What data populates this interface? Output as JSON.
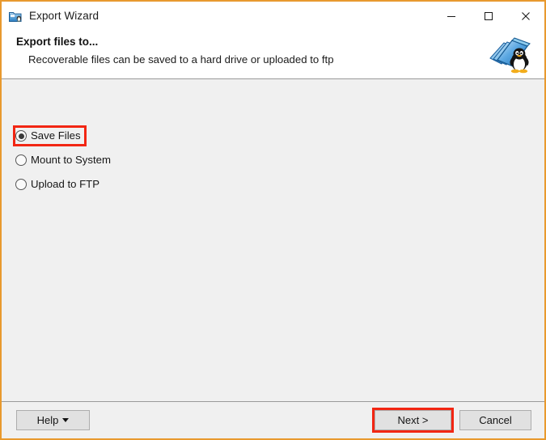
{
  "window": {
    "title": "Export Wizard",
    "icon": "folder-penguin-icon",
    "border_color": "#E8992E",
    "controls": [
      {
        "name": "minimize",
        "glyph": "minimize-icon"
      },
      {
        "name": "maximize",
        "glyph": "maximize-icon"
      },
      {
        "name": "close",
        "glyph": "close-icon"
      }
    ]
  },
  "header": {
    "title": "Export files to...",
    "subtitle": "Recoverable files can be saved to a hard drive or uploaded to ftp",
    "logo": "linux-tux-folder-logo"
  },
  "content": {
    "options": [
      {
        "label": "Save Files",
        "selected": true,
        "highlighted": true
      },
      {
        "label": "Mount to System",
        "selected": false,
        "highlighted": false
      },
      {
        "label": "Upload to FTP",
        "selected": false,
        "highlighted": false
      }
    ]
  },
  "footer": {
    "help_label": "Help",
    "next_label": "Next >",
    "cancel_label": "Cancel",
    "highlight_color": "#F22613"
  }
}
